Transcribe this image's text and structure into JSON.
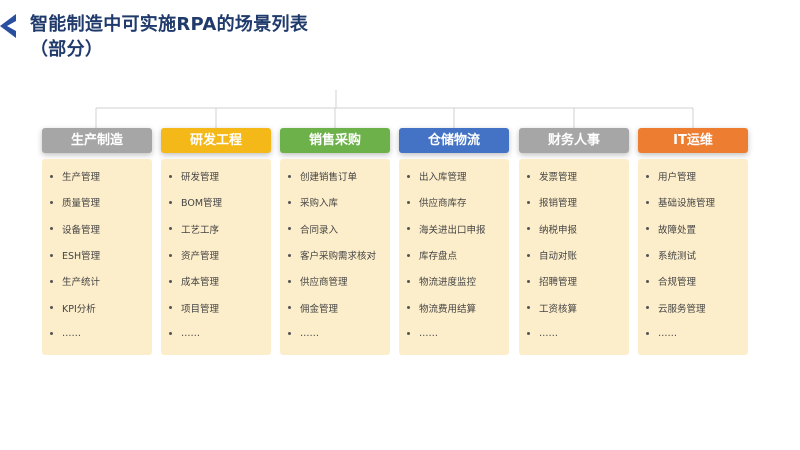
{
  "title": {
    "line1": "智能制造中可实施RPA的场景列表",
    "line2": "（部分）"
  },
  "colors": {
    "title": "#1f3a6b",
    "logo": "#2a4f9e",
    "connector": "#d0d0d0",
    "card_bg": "#fdeecb"
  },
  "columns": [
    {
      "header": "生产制造",
      "color": "#a6a6a6",
      "items": [
        "生产管理",
        "质量管理",
        "设备管理",
        "ESH管理",
        "生产统计",
        "KPI分析",
        "……"
      ]
    },
    {
      "header": "研发工程",
      "color": "#f5b819",
      "items": [
        "研发管理",
        "BOM管理",
        "工艺工序",
        "资产管理",
        "成本管理",
        "项目管理",
        "……"
      ]
    },
    {
      "header": "销售采购",
      "color": "#6db14a",
      "items": [
        "创建销售订单",
        "采购入库",
        "合同录入",
        "客户采购需求核对",
        "供应商管理",
        "佣金管理",
        "……"
      ]
    },
    {
      "header": "仓储物流",
      "color": "#4472c4",
      "items": [
        "出入库管理",
        "供应商库存",
        "海关进出口申报",
        "库存盘点",
        "物流进度监控",
        "物流费用结算",
        "……"
      ]
    },
    {
      "header": "财务人事",
      "color": "#a6a6a6",
      "items": [
        "发票管理",
        "报销管理",
        "纳税申报",
        "自动对账",
        "招聘管理",
        "工资核算",
        "……"
      ]
    },
    {
      "header": "IT运维",
      "color": "#ed7d31",
      "items": [
        "用户管理",
        "基础设施管理",
        "故障处置",
        "系统测试",
        "合规管理",
        "云服务管理",
        "……"
      ]
    }
  ]
}
